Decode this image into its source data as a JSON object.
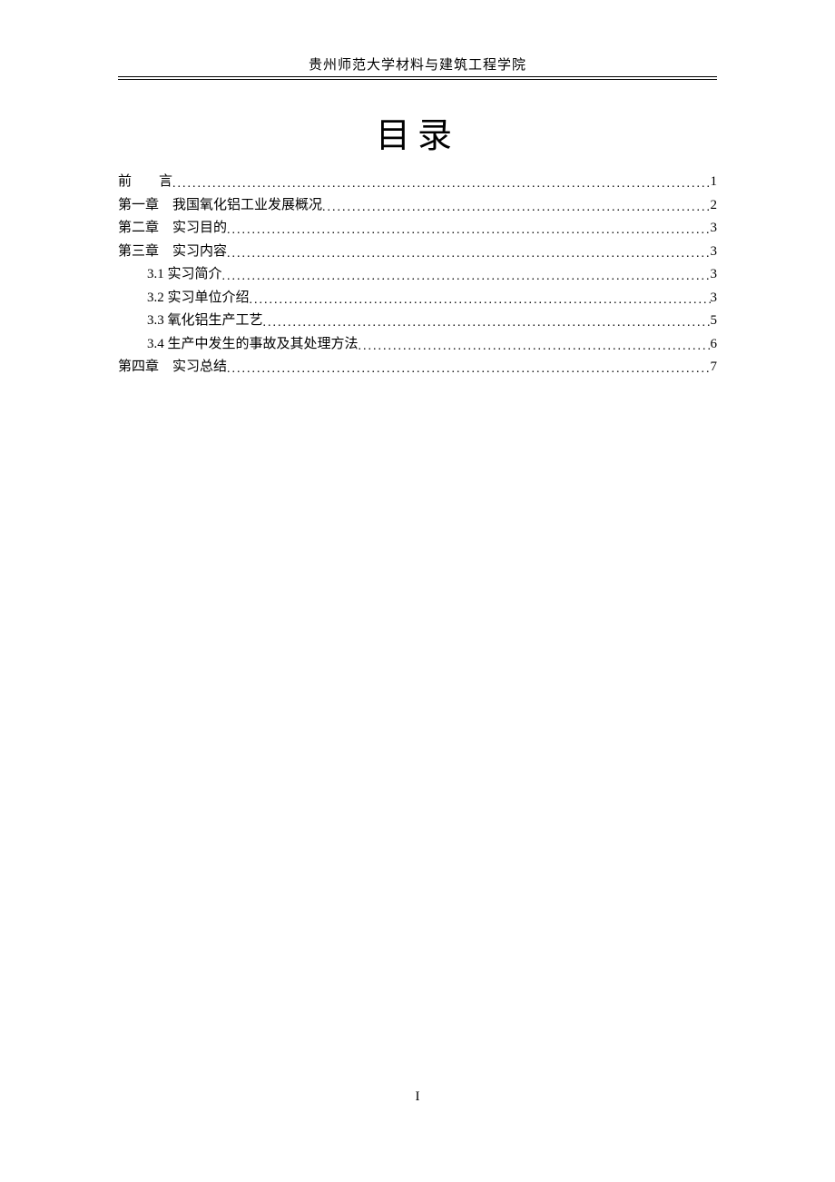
{
  "header": "贵州师范大学材料与建筑工程学院",
  "title": "目录",
  "toc": [
    {
      "label": "前　　言",
      "page": "1",
      "indent": 0
    },
    {
      "label": "第一章　我国氧化铝工业发展概况",
      "page": "2",
      "indent": 0
    },
    {
      "label": "第二章　实习目的",
      "page": "3",
      "indent": 0
    },
    {
      "label": "第三章　实习内容",
      "page": "3",
      "indent": 0
    },
    {
      "label": "3.1 实习简介",
      "page": "3",
      "indent": 1
    },
    {
      "label": "3.2 实习单位介绍",
      "page": "3",
      "indent": 1
    },
    {
      "label": "3.3 氧化铝生产工艺",
      "page": "5",
      "indent": 1
    },
    {
      "label": "3.4 生产中发生的事故及其处理方法",
      "page": "6",
      "indent": 1
    },
    {
      "label": "第四章　实习总结",
      "page": "7",
      "indent": 0
    }
  ],
  "page_number": "I"
}
